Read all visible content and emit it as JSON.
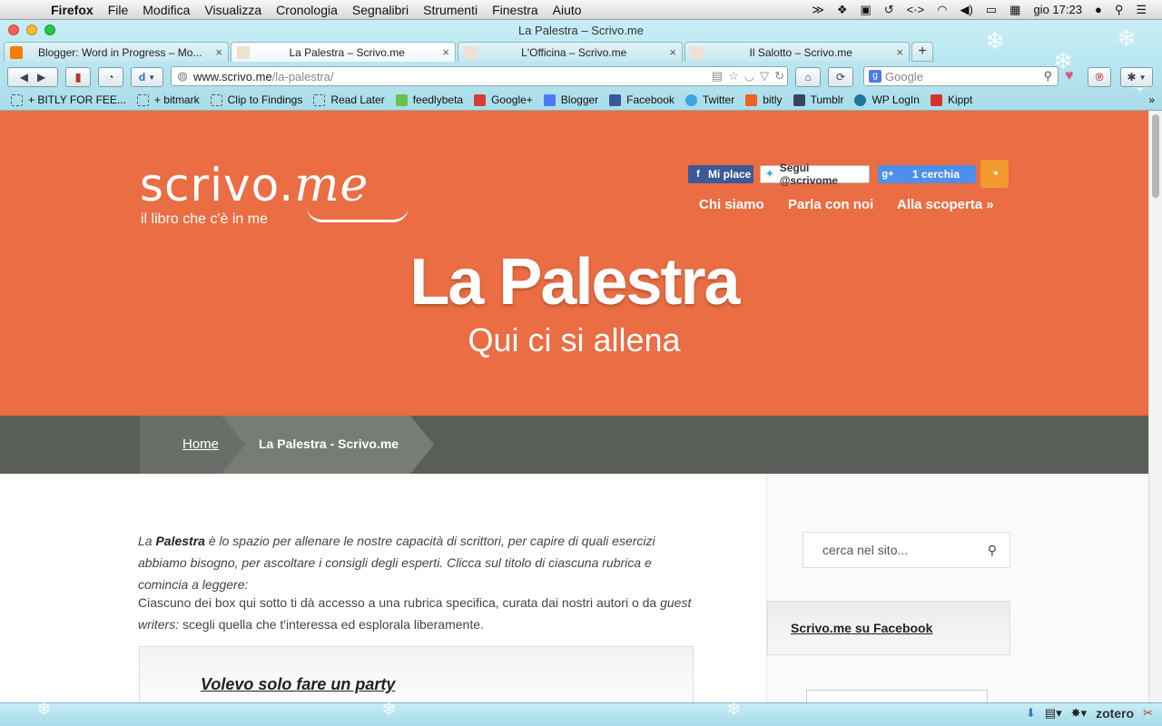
{
  "menubar": {
    "apple": "",
    "items": [
      "Firefox",
      "File",
      "Modifica",
      "Visualizza",
      "Cronologia",
      "Segnalibri",
      "Strumenti",
      "Finestra",
      "Aiuto"
    ],
    "clock": "gio 17:23"
  },
  "window": {
    "title": "La Palestra – Scrivo.me"
  },
  "tabs": [
    {
      "label": "Blogger: Word in Progress – Mo...",
      "favicon_color": "#f57d00"
    },
    {
      "label": "La Palestra – Scrivo.me",
      "favicon_color": "#f0e0d0"
    },
    {
      "label": "L'Officina – Scrivo.me",
      "favicon_color": "#f0e0d0"
    },
    {
      "label": "Il Salotto – Scrivo.me",
      "favicon_color": "#f0e0d0"
    }
  ],
  "tab_close": "×",
  "new_tab": "+",
  "urlbar": {
    "host": "www.scrivo.me",
    "path": "/la-palestra/"
  },
  "search": {
    "placeholder": "Google",
    "engine": "g"
  },
  "bookmarks": [
    {
      "label": "+ BITLY FOR FEE...",
      "icon": "dashed-icon"
    },
    {
      "label": "+ bitmark",
      "icon": "dashed-icon"
    },
    {
      "label": "Clip to Findings",
      "icon": "dashed-icon"
    },
    {
      "label": "Read Later",
      "icon": "dashed-icon"
    },
    {
      "label": "feedlybeta",
      "icon": "feedly-icon"
    },
    {
      "label": "Google+",
      "icon": "googleplus-icon"
    },
    {
      "label": "Blogger",
      "icon": "blogger-icon"
    },
    {
      "label": "Facebook",
      "icon": "facebook-icon"
    },
    {
      "label": "Twitter",
      "icon": "twitter-icon"
    },
    {
      "label": "bitly",
      "icon": "bitly-icon"
    },
    {
      "label": "Tumblr",
      "icon": "tumblr-icon"
    },
    {
      "label": "WP LogIn",
      "icon": "wordpress-icon"
    },
    {
      "label": "Kippt",
      "icon": "kippt-icon"
    }
  ],
  "site": {
    "logo_text": "scrivo.",
    "logo_me": "me",
    "tagline": "il libro che c'è in me",
    "social": {
      "facebook": "Mi place",
      "twitter": "Segui @scrivome",
      "googleplus": "1 cerchia"
    },
    "nav": {
      "chi_siamo": "Chi siamo",
      "parla": "Parla con noi",
      "alla_scoperta": "Alla scoperta »"
    },
    "hero_title": "La Palestra",
    "hero_subtitle": "Qui ci si allena",
    "breadcrumb": {
      "home": "Home",
      "current": "La Palestra - Scrivo.me"
    },
    "intro_prefix": "La ",
    "intro_bold": "Palestra",
    "intro_rest": " è lo spazio per allenare le nostre capacità di scrittori, per capire di quali esercizi abbiamo bisogno, per ascoltare i consigli degli esperti. Clicca sul titolo di ciascuna rubrica e comincia a leggere:",
    "intro2_a": "Ciascuno dei box qui sotto ti dà accesso a una rubrica specifica, curata dai nostri autori o da ",
    "intro2_italic": "guest writers:",
    "intro2_b": " scegli quella che t'interessa ed esplorala liberamente.",
    "box_title": "Volevo solo fare un party",
    "search_placeholder": "cerca nel sito...",
    "fb_widget_title": "Scrivo.me su Facebook"
  },
  "addon": {
    "zotero": "zotero"
  },
  "colors": {
    "hero": "#ea6d43",
    "breadcrumb": "#5a5e58",
    "facebook": "#3b5998",
    "googleplus": "#4d8fea",
    "rss": "#f29a2e"
  }
}
